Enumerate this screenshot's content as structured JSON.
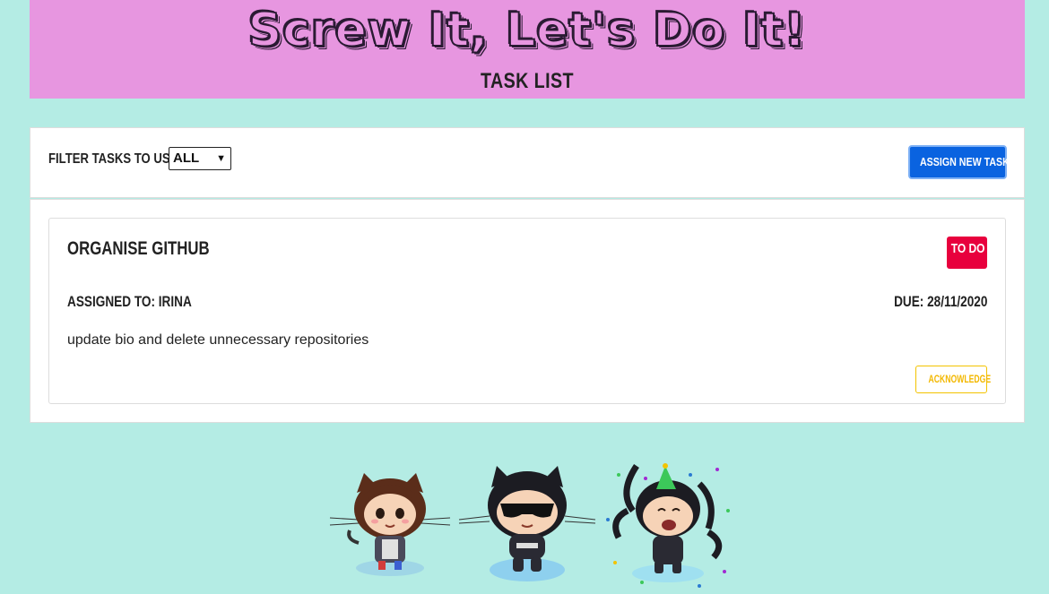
{
  "header": {
    "title": "Screw It, Let's Do It!",
    "subtitle": "TASK LIST"
  },
  "filter": {
    "label": "FILTER TASKS TO USER:",
    "selected": "ALL"
  },
  "actions": {
    "assign_label": "ASSIGN NEW TASK"
  },
  "tasks": [
    {
      "title": "ORGANISE GITHUB",
      "status": "TO DO",
      "assigned": "ASSIGNED TO: IRINA",
      "due": "DUE: 28/11/2020",
      "description": "update bio and delete unnecessary repositories",
      "ack_label": "ACKNOWLEDGE"
    }
  ],
  "colors": {
    "background": "#b4ece4",
    "header_bg": "#e796e0",
    "primary_button": "#0a63e0",
    "status_todo": "#e8003d",
    "acknowledge": "#f3b800"
  },
  "mascots": [
    "octocat-girl-icon",
    "octocat-sunglasses-icon",
    "octocat-party-icon"
  ]
}
